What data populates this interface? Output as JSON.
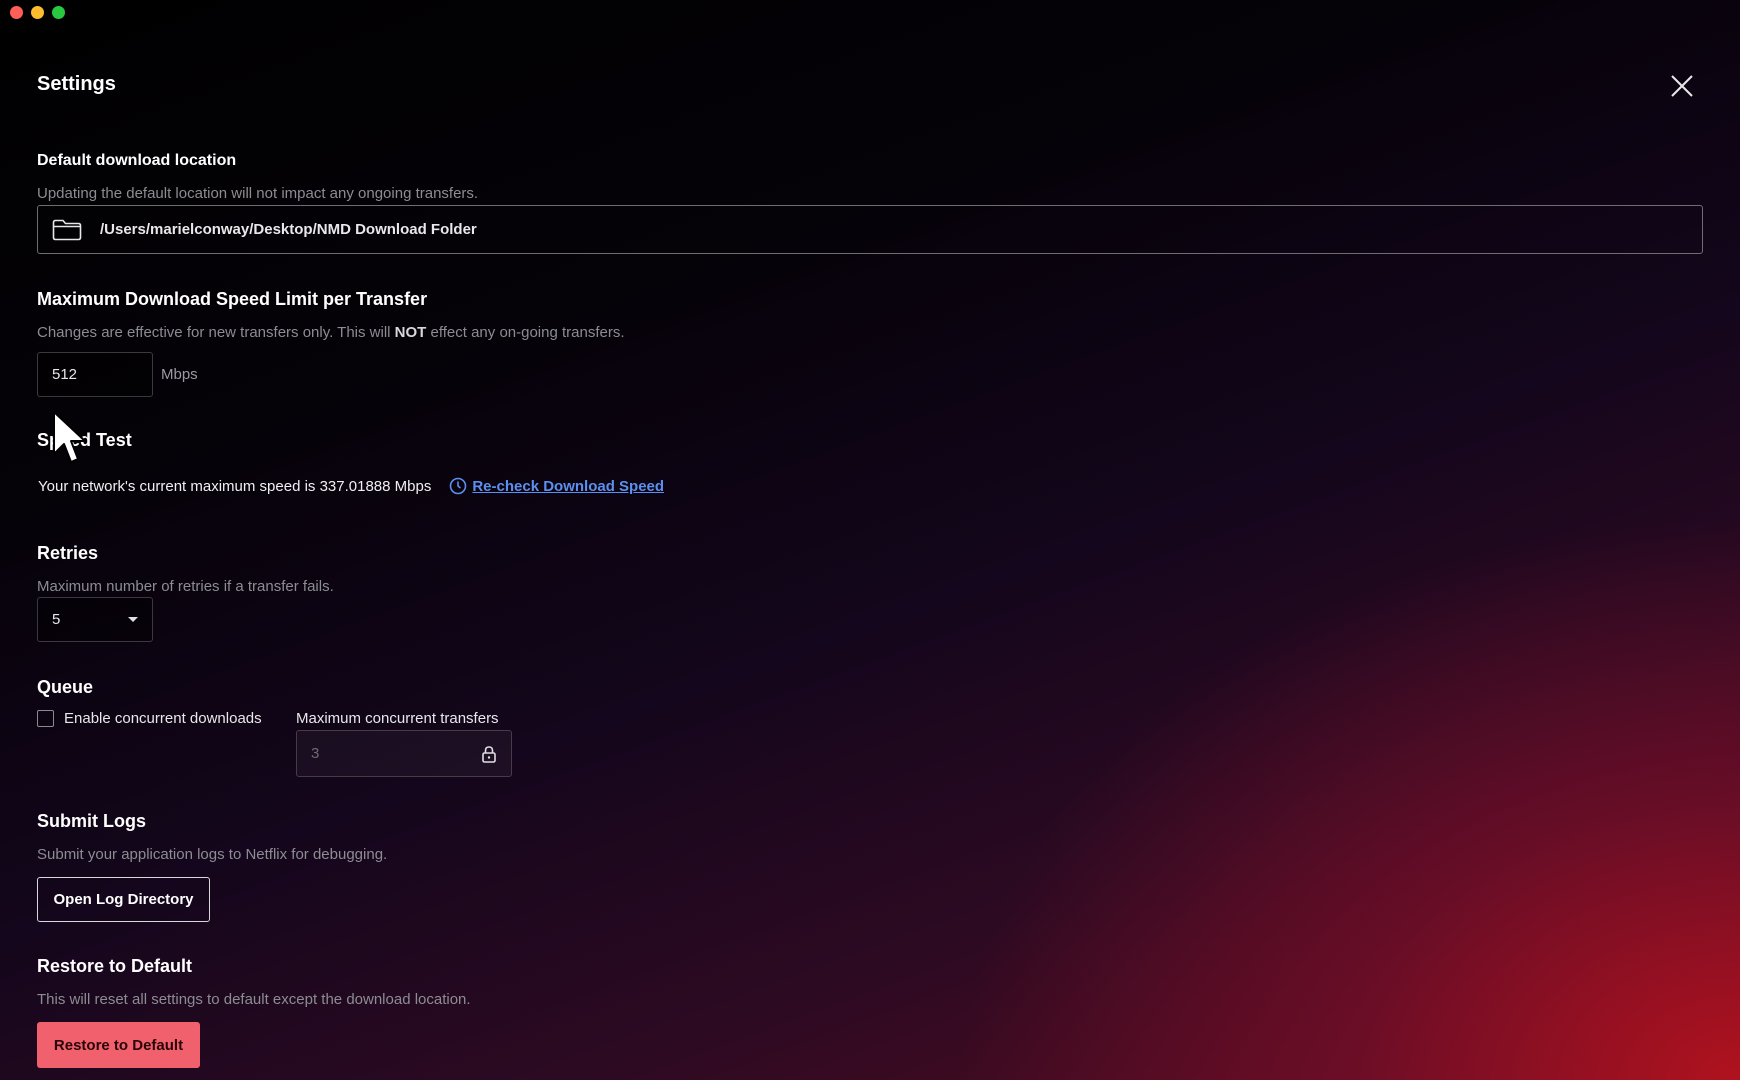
{
  "window": {
    "title": "Settings",
    "close_icon": "close-icon"
  },
  "download_location": {
    "title": "Default download location",
    "description": "Updating the default location will not impact any ongoing transfers.",
    "path": "/Users/marielconway/Desktop/NMD Download Folder",
    "icon": "folder-icon"
  },
  "speed_limit": {
    "title": "Maximum Download Speed Limit per Transfer",
    "description_prefix": "Changes are effective for new transfers only. This will ",
    "description_bold": "NOT",
    "description_suffix": " effect any on-going transfers.",
    "value": "512",
    "unit": "Mbps"
  },
  "speed_test": {
    "title": "Speed Test",
    "result_text": "Your network's current maximum speed is 337.01888 Mbps",
    "recheck_label": "Re-check Download Speed",
    "recheck_icon": "clock-icon"
  },
  "retries": {
    "title": "Retries",
    "description": "Maximum number of retries if a transfer fails.",
    "selected": "5"
  },
  "queue": {
    "title": "Queue",
    "checkbox_label": "Enable concurrent downloads",
    "checkbox_checked": false,
    "max_label": "Maximum concurrent transfers",
    "max_value": "3",
    "lock_icon": "lock-icon"
  },
  "submit_logs": {
    "title": "Submit Logs",
    "description": "Submit your application logs to Netflix for debugging.",
    "button_label": "Open Log Directory"
  },
  "restore": {
    "title": "Restore to Default",
    "description": "This will reset all settings to default except the download location.",
    "button_label": "Restore to Default"
  },
  "colors": {
    "link": "#5b8ff0",
    "danger_button": "#f0616d",
    "background_accent": "#b0121e"
  }
}
